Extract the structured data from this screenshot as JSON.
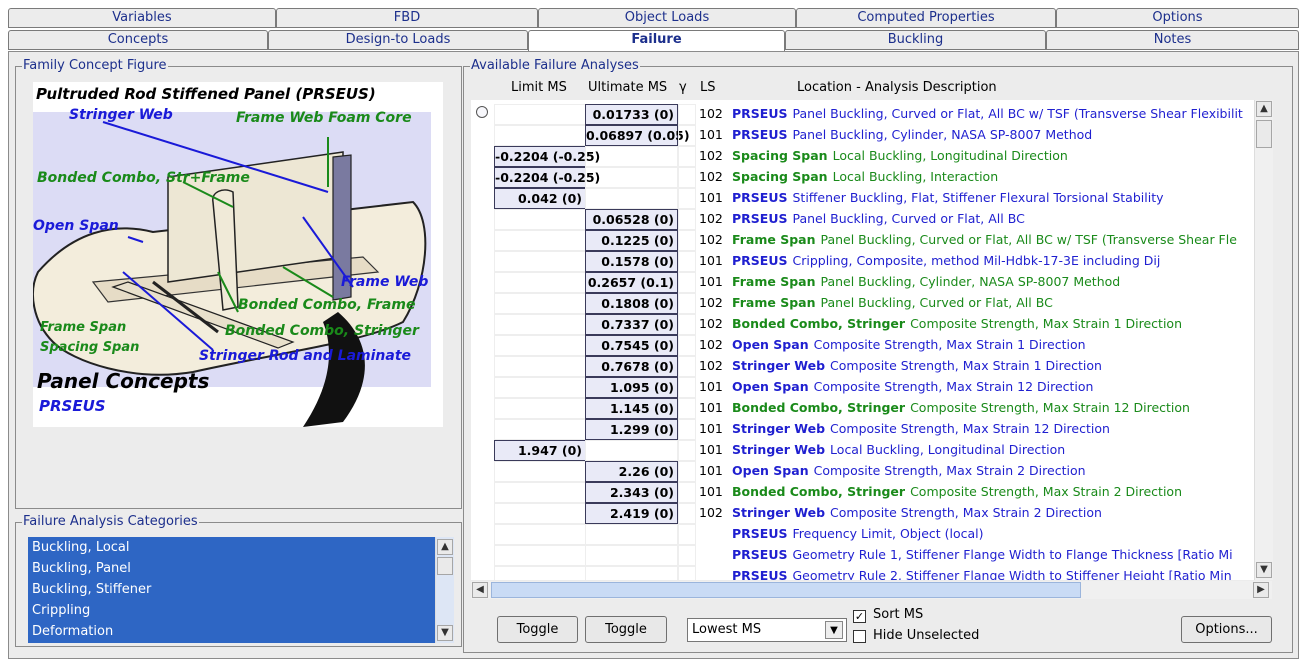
{
  "tabs_top": [
    "Variables",
    "FBD",
    "Object Loads",
    "Computed Properties",
    "Options"
  ],
  "tabs_bottom": [
    "Concepts",
    "Design-to Loads",
    "Failure",
    "Buckling",
    "Notes"
  ],
  "active_tab": "Failure",
  "family_panel": {
    "legend": "Family Concept Figure",
    "figure": {
      "title": "Pultruded Rod Stiffened Panel (PRSEUS)",
      "labels": {
        "stringer_web": "Stringer Web",
        "frame_web_foam_core": "Frame Web Foam Core",
        "bonded_combo_str_frame": "Bonded Combo, Str+Frame",
        "open_span": "Open Span",
        "frame_web": "Frame Web",
        "bonded_combo_frame": "Bonded Combo, Frame",
        "frame_span": "Frame Span",
        "bonded_combo_stringer": "Bonded Combo, Stringer",
        "spacing_span": "Spacing Span",
        "stringer_rod_and_laminate": "Stringer Rod and Laminate"
      },
      "caption": "Panel Concepts",
      "subcaption": "PRSEUS"
    }
  },
  "categories": {
    "legend": "Failure Analysis Categories",
    "items": [
      "Buckling, Local",
      "Buckling, Panel",
      "Buckling, Stiffener",
      "Crippling",
      "Deformation"
    ]
  },
  "analyses": {
    "legend": "Available Failure Analyses",
    "headers": {
      "limit": "Limit MS",
      "ultimate": "Ultimate MS",
      "gamma": "γ",
      "ls": "LS",
      "desc": "Location - Analysis Description"
    },
    "rows": [
      {
        "limit": "",
        "ult": "0.01733 (0)",
        "ls": "102",
        "obj": "PRSEUS",
        "color": "blue",
        "text": "Panel Buckling, Curved or Flat, All BC w/ TSF (Transverse Shear Flexibilit"
      },
      {
        "limit": "",
        "ult": "0.06897 (0.05)",
        "ls": "101",
        "obj": "PRSEUS",
        "color": "blue",
        "text": "Panel Buckling, Cylinder, NASA SP-8007 Method"
      },
      {
        "limit": "-0.2204 (-0.25)",
        "ult": "",
        "ls": "102",
        "obj": "Spacing Span",
        "color": "green",
        "text": "Local Buckling, Longitudinal Direction"
      },
      {
        "limit": "-0.2204 (-0.25)",
        "ult": "",
        "ls": "102",
        "obj": "Spacing Span",
        "color": "green",
        "text": "Local Buckling, Interaction"
      },
      {
        "limit": "0.042 (0)",
        "ult": "",
        "ls": "101",
        "obj": "PRSEUS",
        "color": "blue",
        "text": "Stiffener Buckling, Flat, Stiffener Flexural Torsional Stability"
      },
      {
        "limit": "",
        "ult": "0.06528 (0)",
        "ls": "102",
        "obj": "PRSEUS",
        "color": "blue",
        "text": "Panel Buckling, Curved or Flat, All BC"
      },
      {
        "limit": "",
        "ult": "0.1225 (0)",
        "ls": "102",
        "obj": "Frame Span",
        "color": "green",
        "text": "Panel Buckling, Curved or Flat, All BC w/ TSF (Transverse Shear Fle"
      },
      {
        "limit": "",
        "ult": "0.1578 (0)",
        "ls": "101",
        "obj": "PRSEUS",
        "color": "blue",
        "text": "Crippling, Composite, method Mil-Hdbk-17-3E including Dij"
      },
      {
        "limit": "",
        "ult": "0.2657 (0.1)",
        "ls": "101",
        "obj": "Frame Span",
        "color": "green",
        "text": "Panel Buckling, Cylinder, NASA SP-8007 Method"
      },
      {
        "limit": "",
        "ult": "0.1808 (0)",
        "ls": "102",
        "obj": "Frame Span",
        "color": "green",
        "text": "Panel Buckling, Curved or Flat, All BC"
      },
      {
        "limit": "",
        "ult": "0.7337 (0)",
        "ls": "102",
        "obj": "Bonded Combo, Stringer",
        "color": "green",
        "text": "Composite Strength, Max Strain 1 Direction"
      },
      {
        "limit": "",
        "ult": "0.7545 (0)",
        "ls": "102",
        "obj": "Open Span",
        "color": "blue",
        "text": "Composite Strength, Max Strain 1 Direction"
      },
      {
        "limit": "",
        "ult": "0.7678 (0)",
        "ls": "102",
        "obj": "Stringer Web",
        "color": "blue",
        "text": "Composite Strength, Max Strain 1 Direction"
      },
      {
        "limit": "",
        "ult": "1.095 (0)",
        "ls": "101",
        "obj": "Open Span",
        "color": "blue",
        "text": "Composite Strength, Max Strain 12 Direction"
      },
      {
        "limit": "",
        "ult": "1.145 (0)",
        "ls": "101",
        "obj": "Bonded Combo, Stringer",
        "color": "green",
        "text": "Composite Strength, Max Strain 12 Direction"
      },
      {
        "limit": "",
        "ult": "1.299 (0)",
        "ls": "101",
        "obj": "Stringer Web",
        "color": "blue",
        "text": "Composite Strength, Max Strain 12 Direction"
      },
      {
        "limit": "1.947 (0)",
        "ult": "",
        "ls": "101",
        "obj": "Stringer Web",
        "color": "blue",
        "text": "Local Buckling, Longitudinal Direction"
      },
      {
        "limit": "",
        "ult": "2.26 (0)",
        "ls": "101",
        "obj": "Open Span",
        "color": "blue",
        "text": "Composite Strength, Max Strain 2 Direction"
      },
      {
        "limit": "",
        "ult": "2.343 (0)",
        "ls": "101",
        "obj": "Bonded Combo, Stringer",
        "color": "green",
        "text": "Composite Strength, Max Strain 2 Direction"
      },
      {
        "limit": "",
        "ult": "2.419 (0)",
        "ls": "102",
        "obj": "Stringer Web",
        "color": "blue",
        "text": "Composite Strength, Max Strain 2 Direction"
      },
      {
        "limit": "",
        "ult": "",
        "ls": "",
        "obj": "PRSEUS",
        "color": "blue",
        "text": "Frequency Limit, Object (local)"
      },
      {
        "limit": "",
        "ult": "",
        "ls": "",
        "obj": "PRSEUS",
        "color": "blue",
        "text": "Geometry Rule 1, Stiffener Flange Width to Flange Thickness [Ratio Mi"
      },
      {
        "limit": "",
        "ult": "",
        "ls": "",
        "obj": "PRSEUS",
        "color": "blue",
        "text": "Geometry Rule 2, Stiffener Flange Width to Stiffener Height [Ratio Min"
      }
    ]
  },
  "bottom": {
    "toggle1": "Toggle",
    "toggle2": "Toggle",
    "dropdown_value": "Lowest MS",
    "sort_ms": "Sort MS",
    "hide_unselected": "Hide Unselected",
    "options": "Options...",
    "sort_checked": true,
    "hide_checked": false
  },
  "colors": {
    "blue": "#1f1fd0",
    "green": "#1a8a1a",
    "selection": "#2e66c4"
  }
}
